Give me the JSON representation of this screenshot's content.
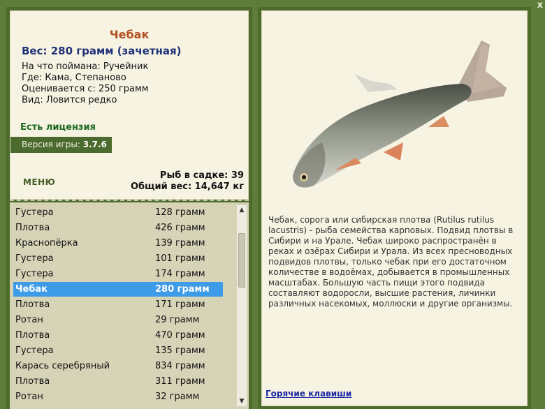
{
  "window": {
    "close_label": "x"
  },
  "fish": {
    "title": "Чебак",
    "weight_line": "Вес: 280 грамм (зачетная)",
    "bait": "На что поймана: Ручейник",
    "where": "Где: Кама, Степаново",
    "rated_from": "Оценивается с: 250 грамм",
    "kind": "Вид: Ловится редко"
  },
  "license": "Есть лицензия",
  "version": {
    "label": "Версия игры:",
    "value": "3.7.6"
  },
  "menu_label": "МЕНЮ",
  "counts": {
    "fish_in_net": "Рыб в садке: 39",
    "total_weight": "Общий вес: 14,647 кг"
  },
  "catch_list": [
    {
      "name": "Густера",
      "weight": "128 грамм"
    },
    {
      "name": "Плотва",
      "weight": "426 грамм"
    },
    {
      "name": "Краснопёрка",
      "weight": "139 грамм"
    },
    {
      "name": "Густера",
      "weight": "101 грамм"
    },
    {
      "name": "Густера",
      "weight": "174 грамм"
    },
    {
      "name": "Чебак",
      "weight": "280 грамм",
      "selected": true
    },
    {
      "name": "Плотва",
      "weight": "171 грамм"
    },
    {
      "name": "Ротан",
      "weight": "29 грамм"
    },
    {
      "name": "Плотва",
      "weight": "470 грамм"
    },
    {
      "name": "Густера",
      "weight": "135 грамм"
    },
    {
      "name": "Карась серебряный",
      "weight": "834 грамм"
    },
    {
      "name": "Плотва",
      "weight": "311 грамм"
    },
    {
      "name": "Ротан",
      "weight": "32 грамм"
    }
  ],
  "description": "Чебак, сорога или сибирская плотва (Rutilus rutilus lacustris) - рыба семейства карповых. Подвид плотвы в Сибири и на Урале. Чебак широко распространён в реках и озёрах Сибири и Урала. Из всех пресноводных подвидов плотвы, только чебак при его достаточном количестве в водоёмах, добывается в промышленных масштабах. Большую часть пищи этого подвида составляют водоросли, высшие растения, личинки различных насекомых, моллюски и другие организмы.",
  "hotkeys_label": "Горячие клавиши",
  "colors": {
    "accent": "#3d9be8",
    "frame": "#4d6c2c",
    "title": "#b4501f"
  }
}
